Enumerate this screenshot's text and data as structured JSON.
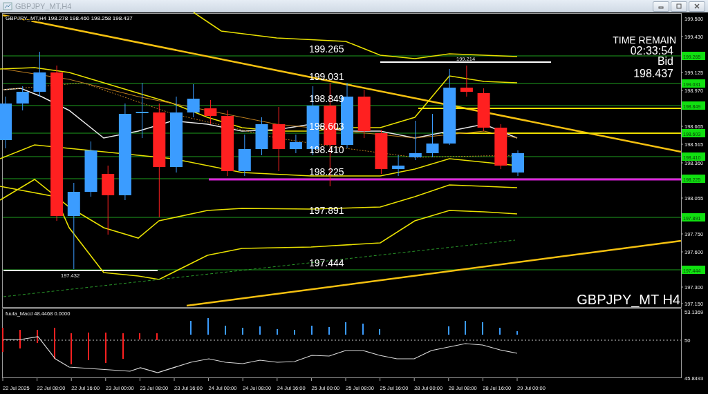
{
  "window": {
    "title": "GBPJPY_MT,H4"
  },
  "chart": {
    "header": "GBPJPY_MT,H4  198.278 198.460 198.258 198.437",
    "symbol_label": "GBPJPY_MT H4",
    "time_remain": {
      "label": "TIME REMAIN",
      "value": "02:33:54",
      "bid_label": "Bid",
      "bid": "198.437"
    },
    "annotations": [
      "199.214",
      "197.432"
    ],
    "levels": [
      {
        "label": "199.265",
        "tag": "199.265"
      },
      {
        "label": "199.031",
        "tag": "199.031"
      },
      {
        "label": "198.849",
        "tag": "198.849"
      },
      {
        "label": "198.603",
        "tag": "198.603"
      },
      {
        "label": "198.410",
        "tag": "198.410"
      },
      {
        "label": "198.225",
        "tag": "198.225"
      },
      {
        "label": "197.891",
        "tag": "197.891"
      },
      {
        "label": "197.444",
        "tag": "197.444"
      }
    ],
    "price_axis": [
      "199.580",
      "199.430",
      "199.125",
      "198.970",
      "198.665",
      "198.515",
      "198.360",
      "198.055",
      "197.750",
      "197.600",
      "197.300",
      "197.150"
    ]
  },
  "indicator": {
    "name": "fuuta_Macd",
    "value_1": "48.4468",
    "value_2": "0.0000",
    "axis": [
      "53.1369",
      "50",
      "45.8493"
    ]
  },
  "time_axis": [
    "22 Jul 2025",
    "22 Jul 08:00",
    "22 Jul 16:00",
    "23 Jul 00:00",
    "23 Jul 08:00",
    "23 Jul 16:00",
    "24 Jul 00:00",
    "24 Jul 08:00",
    "24 Jul 16:00",
    "25 Jul 00:00",
    "25 Jul 08:00",
    "25 Jul 16:00",
    "28 Jul 00:00",
    "28 Jul 08:00",
    "28 Jul 16:00",
    "29 Jul 00:00"
  ]
}
